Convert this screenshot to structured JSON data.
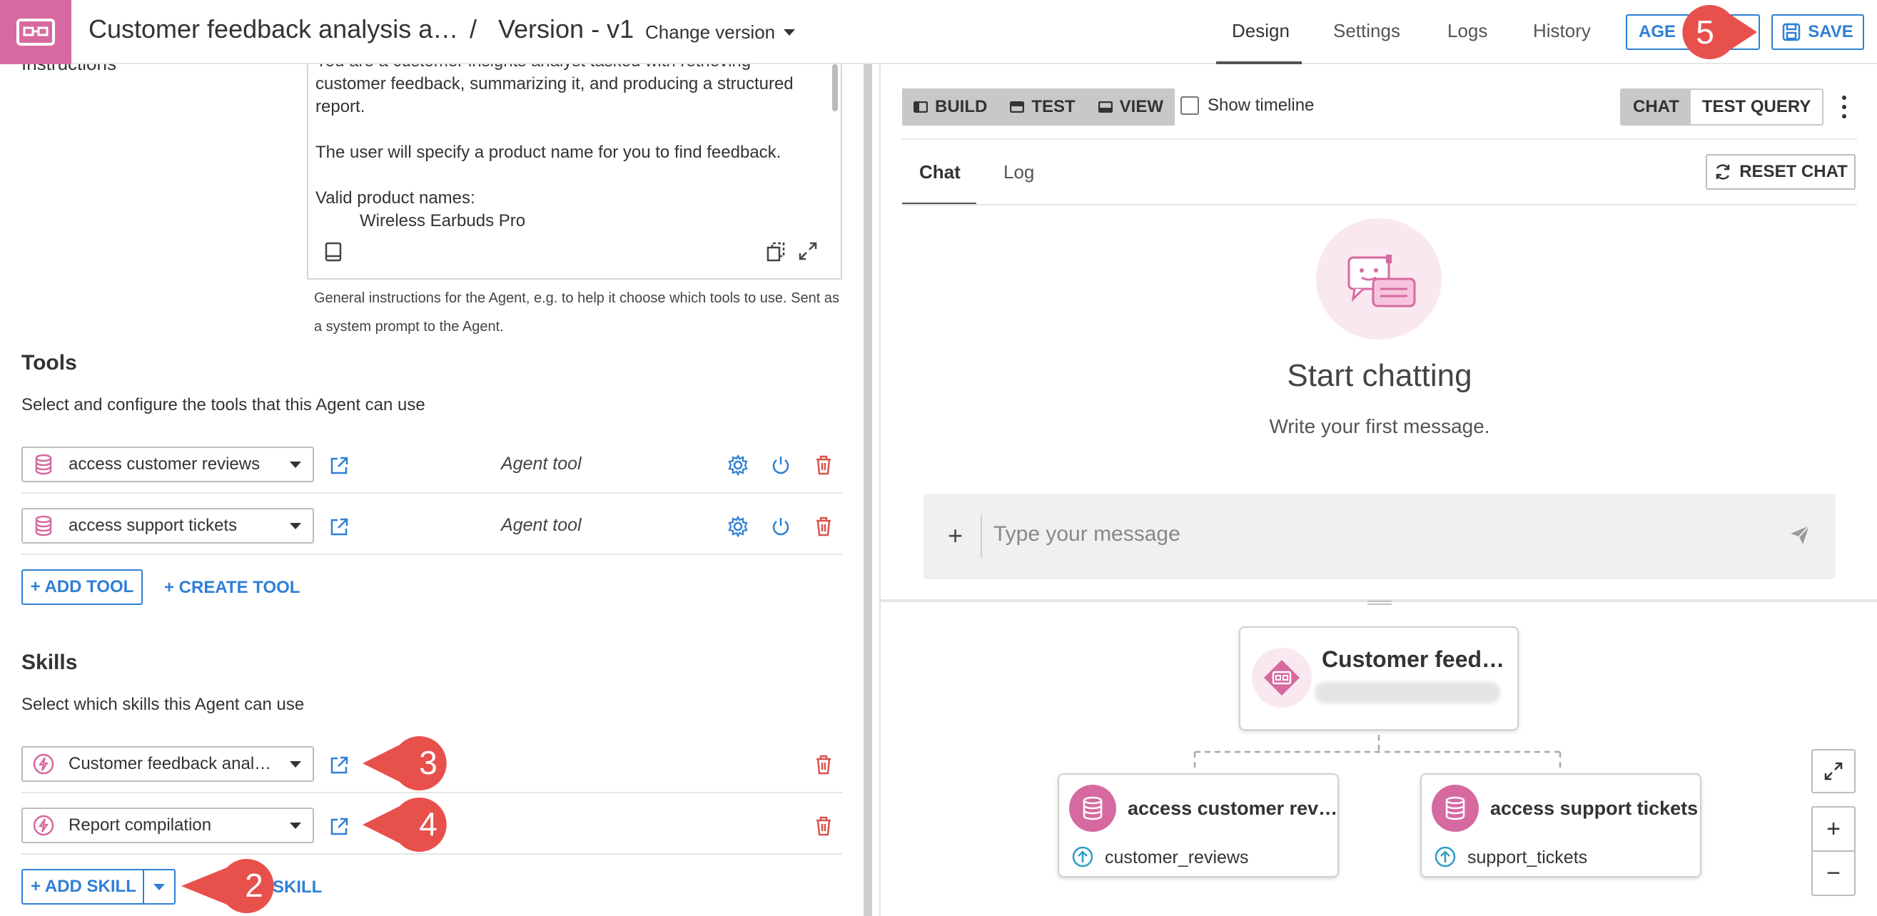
{
  "header": {
    "title": "Customer feedback analysis a…",
    "separator": "/",
    "version": "Version - v1",
    "change_version": "Change version",
    "tabs": [
      {
        "label": "Design",
        "active": true
      },
      {
        "label": "Settings"
      },
      {
        "label": "Logs"
      },
      {
        "label": "History"
      }
    ],
    "agent_button": "AGE",
    "save_button": "SAVE"
  },
  "instructions": {
    "label": "Instructions",
    "paragraphs": [
      "You are a customer insights analyst tasked with retrieving customer feedback, summarizing it, and producing a structured report.",
      "The user will specify a product name for you to find feedback.",
      "Valid product names:"
    ],
    "product_name": "Wireless Earbuds Pro",
    "hint": "General instructions for the Agent, e.g. to help it choose which tools to use. Sent as a system prompt to the Agent."
  },
  "tools": {
    "title": "Tools",
    "subtitle": "Select and configure the tools that this Agent can use",
    "items": [
      {
        "name": "access customer reviews",
        "type": "Agent tool"
      },
      {
        "name": "access support tickets",
        "type": "Agent tool"
      }
    ],
    "add_label": "+ ADD TOOL",
    "create_label": "+ CREATE TOOL"
  },
  "skills": {
    "title": "Skills",
    "subtitle": "Select which skills this Agent can use",
    "items": [
      {
        "name": "Customer feedback anal…"
      },
      {
        "name": "Report compilation"
      }
    ],
    "add_label": "+ ADD SKILL",
    "create_label_visible": "SKILL"
  },
  "callouts": [
    "2",
    "3",
    "4",
    "5"
  ],
  "right": {
    "toolbar": {
      "build": "BUILD",
      "test": "TEST",
      "view": "VIEW"
    },
    "show_timeline": "Show timeline",
    "chat_mode": "CHAT",
    "test_query": "TEST QUERY",
    "subtabs": {
      "chat": "Chat",
      "log": "Log"
    },
    "reset_chat": "RESET CHAT",
    "start_title": "Start chatting",
    "start_sub": "Write your first message.",
    "message_placeholder": "Type your message",
    "message_plus": "+"
  },
  "graph": {
    "agent_node": {
      "title": "Customer feed…"
    },
    "tool_nodes": [
      {
        "title": "access customer rev…",
        "dataset": "customer_reviews"
      },
      {
        "title": "access support tickets",
        "dataset": "support_tickets"
      }
    ],
    "zoom_in": "+",
    "zoom_out": "−"
  },
  "colors": {
    "brand_pink": "#d66aa0",
    "accent_blue": "#2f7fd6",
    "callout_red": "#e8504c",
    "delete_red": "#d9534f"
  }
}
